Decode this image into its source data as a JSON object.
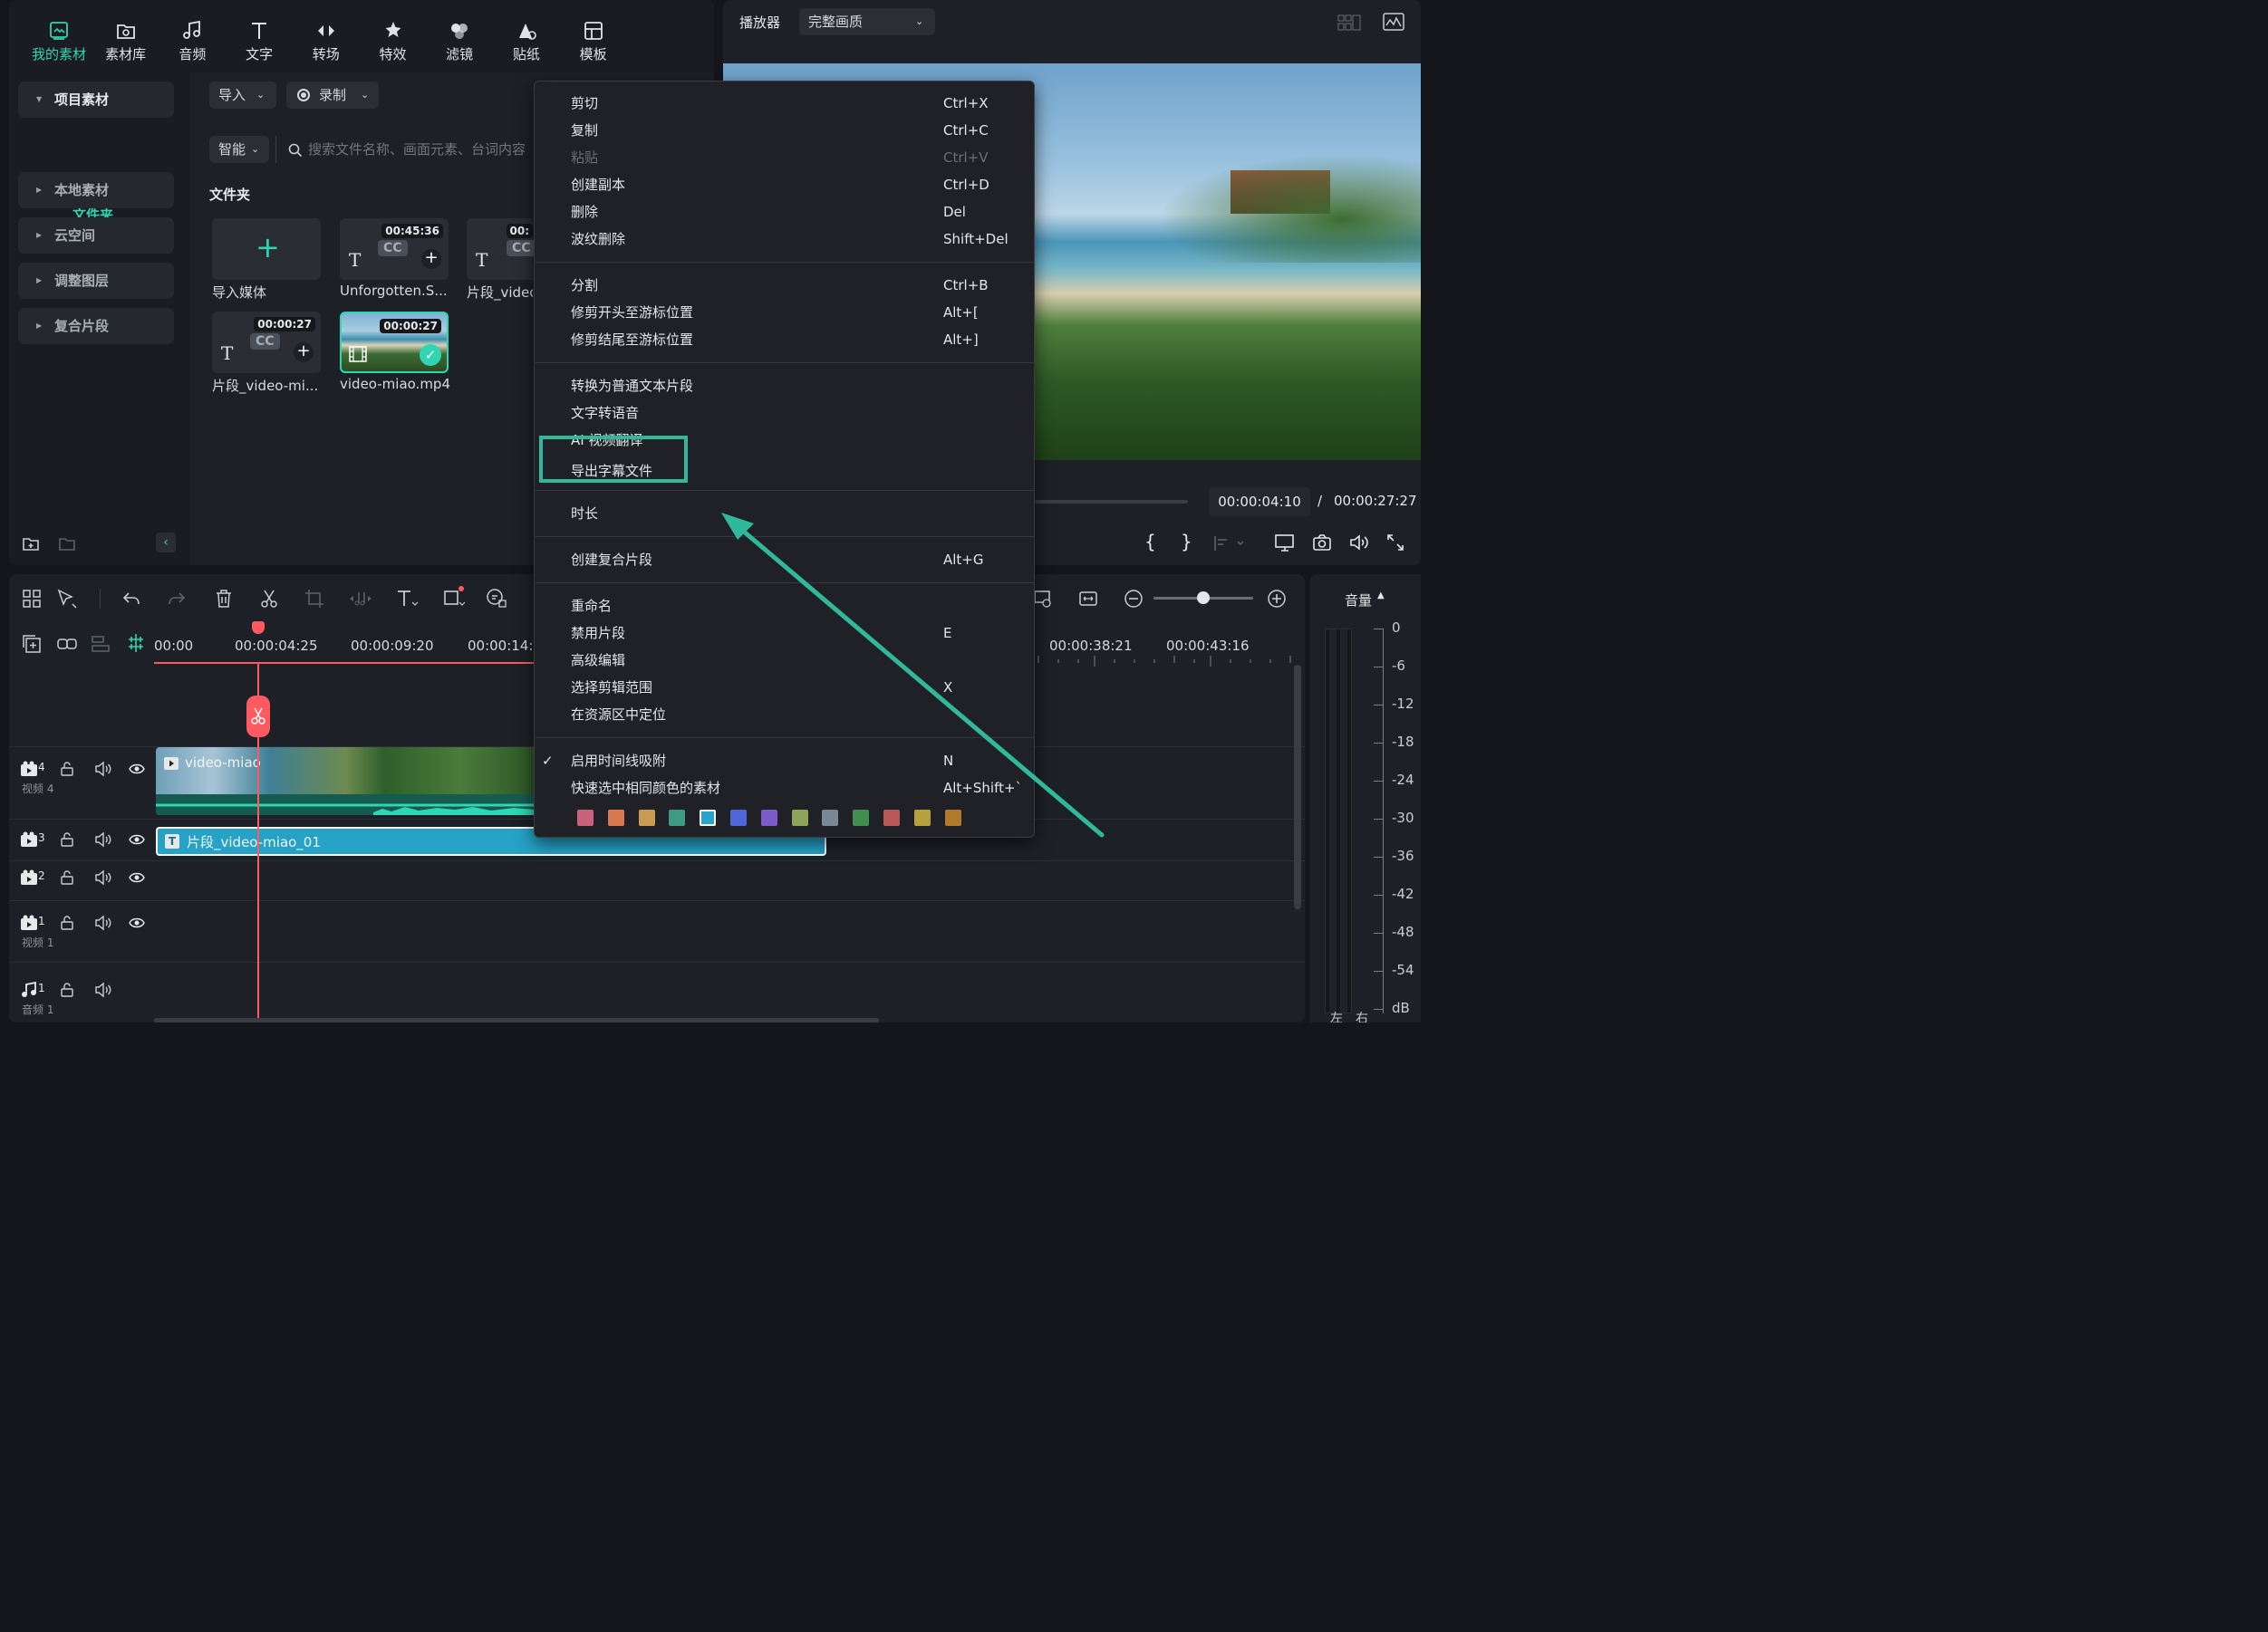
{
  "toolbar": {
    "tabs": [
      {
        "label": "我的素材",
        "icon": "my-media-icon",
        "active": true
      },
      {
        "label": "素材库",
        "icon": "library-icon"
      },
      {
        "label": "音频",
        "icon": "music-note-icon"
      },
      {
        "label": "文字",
        "icon": "text-icon"
      },
      {
        "label": "转场",
        "icon": "transition-icon"
      },
      {
        "label": "特效",
        "icon": "effects-icon"
      },
      {
        "label": "滤镜",
        "icon": "filter-icon"
      },
      {
        "label": "贴纸",
        "icon": "sticker-icon"
      },
      {
        "label": "模板",
        "icon": "template-icon"
      }
    ]
  },
  "sidebar": {
    "project_media": "项目素材",
    "folder": "文件夹",
    "local_media": "本地素材",
    "cloud": "云空间",
    "adjustment_layer": "调整图层",
    "compound_clip": "复合片段"
  },
  "media": {
    "import_label": "导入",
    "record_label": "录制",
    "smart_label": "智能",
    "search_placeholder": "搜索文件名称、画面元素、台词内容",
    "section_title": "文件夹",
    "items": [
      {
        "label": "导入媒体"
      },
      {
        "label": "Unforgotten.S...",
        "duration": "00:45:36"
      },
      {
        "label": "片段_video",
        "duration": "00:"
      },
      {
        "label": "片段_video-mi...",
        "duration": "00:00:27"
      },
      {
        "label": "video-miao.mp4",
        "duration": "00:00:27"
      }
    ]
  },
  "player": {
    "title": "播放器",
    "quality": "完整画质",
    "current_time": "00:00:04:10",
    "separator": "/",
    "total_time": "00:00:27:27",
    "mark_in": "{",
    "mark_out": "}"
  },
  "context_menu": {
    "groups": [
      [
        {
          "label": "剪切",
          "shortcut": "Ctrl+X"
        },
        {
          "label": "复制",
          "shortcut": "Ctrl+C"
        },
        {
          "label": "粘贴",
          "shortcut": "Ctrl+V",
          "disabled": true
        },
        {
          "label": "创建副本",
          "shortcut": "Ctrl+D"
        },
        {
          "label": "删除",
          "shortcut": "Del"
        },
        {
          "label": "波纹删除",
          "shortcut": "Shift+Del"
        }
      ],
      [
        {
          "label": "分割",
          "shortcut": "Ctrl+B"
        },
        {
          "label": "修剪开头至游标位置",
          "shortcut": "Alt+["
        },
        {
          "label": "修剪结尾至游标位置",
          "shortcut": "Alt+]"
        }
      ],
      [
        {
          "label": "转换为普通文本片段",
          "shortcut": ""
        },
        {
          "label": "文字转语音",
          "shortcut": ""
        },
        {
          "label": "AI 视频翻译",
          "shortcut": ""
        },
        {
          "label": "导出字幕文件",
          "shortcut": "",
          "highlighted": true
        }
      ],
      [
        {
          "label": "时长",
          "shortcut": ""
        }
      ],
      [
        {
          "label": "创建复合片段",
          "shortcut": "Alt+G"
        }
      ],
      [
        {
          "label": "重命名",
          "shortcut": ""
        },
        {
          "label": "禁用片段",
          "shortcut": "E"
        },
        {
          "label": "高级编辑",
          "shortcut": ""
        },
        {
          "label": "选择剪辑范围",
          "shortcut": "X"
        },
        {
          "label": "在资源区中定位",
          "shortcut": ""
        }
      ],
      [
        {
          "label": "启用时间线吸附",
          "shortcut": "N",
          "checked": true
        },
        {
          "label": "快速选中相同颜色的素材",
          "shortcut": "Alt+Shift+`"
        }
      ]
    ],
    "color_swatches": [
      "#c9627b",
      "#d8784f",
      "#c99b52",
      "#3e9a83",
      "#2aa5c9",
      "#4f66d6",
      "#7c5cc9",
      "#8fa45a",
      "#7a8896",
      "#3f8f4e",
      "#b95757",
      "#b6a13d",
      "#b07a2a"
    ],
    "highlight_color": "#2fb89a"
  },
  "timeline": {
    "ruler": [
      "00:00",
      "00:00:04:25",
      "00:00:09:20",
      "00:00:14:1",
      "00:00:38:21",
      "00:00:43:16"
    ],
    "tracks": [
      {
        "number": "4",
        "name": "视频 4",
        "type": "video"
      },
      {
        "number": "3",
        "name": "",
        "type": "video"
      },
      {
        "number": "2",
        "name": "",
        "type": "video"
      },
      {
        "number": "1",
        "name": "视频 1",
        "type": "video"
      },
      {
        "number": "1",
        "name": "音频 1",
        "type": "audio"
      }
    ],
    "clips": [
      {
        "label": "video-miao"
      },
      {
        "label": "片段_video-miao_01"
      }
    ],
    "playhead_color": "#ff5a5f",
    "accent_color": "#2ed6b3"
  },
  "meter": {
    "title": "音量",
    "scale": [
      "0",
      "-6",
      "-12",
      "-18",
      "-24",
      "-30",
      "-36",
      "-42",
      "-48",
      "-54",
      "dB"
    ],
    "left_label": "左",
    "right_label": "右"
  }
}
